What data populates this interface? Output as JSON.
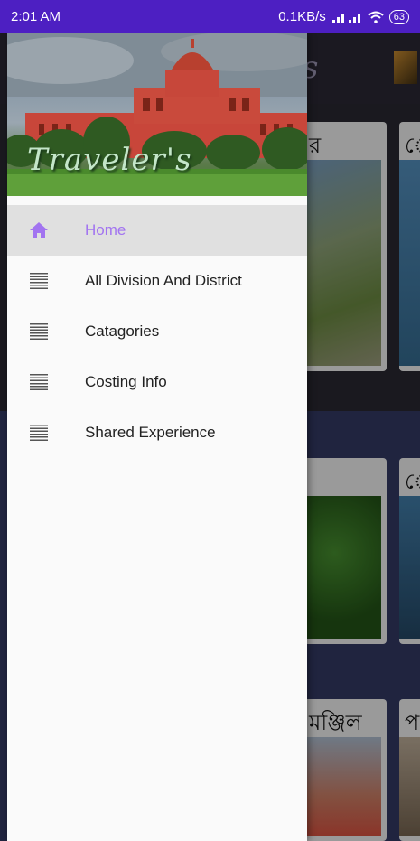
{
  "status_bar": {
    "time": "2:01 AM",
    "network_speed": "0.1KB/s",
    "battery": "63"
  },
  "background": {
    "title_fragment": "s",
    "card_labels": [
      "র",
      "ে",
      "",
      "ে",
      "মঞ্জিল",
      "প"
    ]
  },
  "drawer": {
    "header_title": "Traveler's",
    "menu_items": [
      {
        "label": "Home",
        "icon": "home-icon",
        "active": true
      },
      {
        "label": "All Division And District",
        "icon": "list-icon",
        "active": false
      },
      {
        "label": "Catagories",
        "icon": "list-icon",
        "active": false
      },
      {
        "label": "Costing Info",
        "icon": "list-icon",
        "active": false
      },
      {
        "label": "Shared Experience",
        "icon": "list-icon",
        "active": false
      }
    ]
  },
  "colors": {
    "status_bar": "#4d1fc2",
    "active_accent": "#a274f0",
    "active_bg": "#e0e0e0"
  }
}
